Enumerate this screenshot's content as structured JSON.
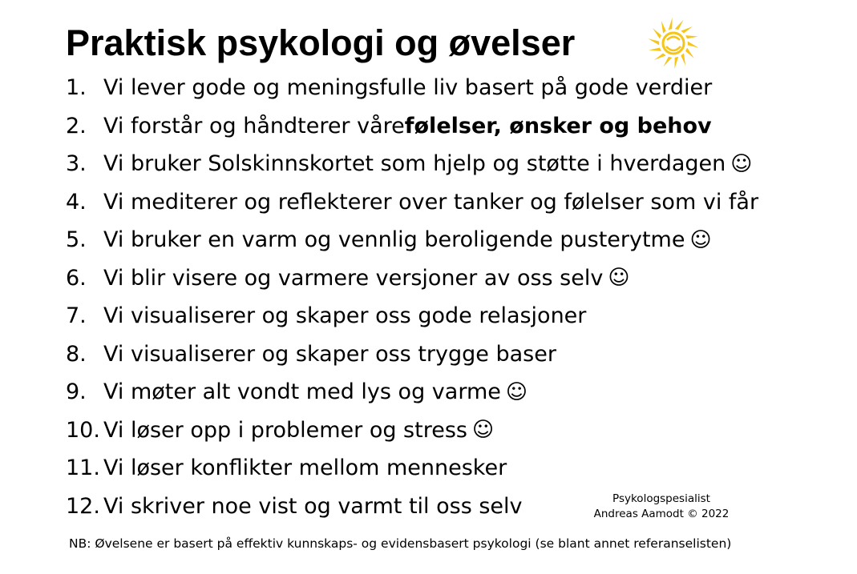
{
  "title": "Praktisk psykologi og øvelser",
  "sun_icon": "sun-icon",
  "accent_color": "#F5C518",
  "items": [
    {
      "num": "1.",
      "text": "Vi lever gode og meningsfulle liv basert på gode verdier",
      "bold": "",
      "smiley": ""
    },
    {
      "num": "2.",
      "text": "Vi forstår og håndterer våre ",
      "bold": "følelser, ønsker og behov",
      "smiley": ""
    },
    {
      "num": "3.",
      "text": "Vi bruker Solskinnskortet som hjelp og støtte i hverdagen",
      "bold": "",
      "smiley": "☺"
    },
    {
      "num": "4.",
      "text": "Vi mediterer og reflekterer over tanker og følelser som vi får",
      "bold": "",
      "smiley": ""
    },
    {
      "num": "5.",
      "text": "Vi bruker en varm og vennlig beroligende pusterytme",
      "bold": "",
      "smiley": "☺"
    },
    {
      "num": "6.",
      "text": "Vi blir visere og varmere versjoner av oss selv",
      "bold": "",
      "smiley": "☺"
    },
    {
      "num": "7.",
      "text": "Vi visualiserer og skaper oss gode relasjoner",
      "bold": "",
      "smiley": ""
    },
    {
      "num": "8.",
      "text": "Vi visualiserer og skaper oss trygge baser",
      "bold": "",
      "smiley": ""
    },
    {
      "num": "9.",
      "text": "Vi møter alt vondt med lys og varme",
      "bold": "",
      "smiley": "☺"
    },
    {
      "num": "10.",
      "text": "Vi løser opp i problemer og stress",
      "bold": "",
      "smiley": "☺"
    },
    {
      "num": "11.",
      "text": "Vi løser konflikter mellom mennesker",
      "bold": "",
      "smiley": ""
    },
    {
      "num": "12.",
      "text": "Vi skriver noe vist og varmt til oss selv",
      "bold": "",
      "smiley": ""
    }
  ],
  "credit": {
    "line1": "Psykologspesialist",
    "line2": "Andreas Aamodt © 2022"
  },
  "note": "NB: Øvelsene er basert på effektiv kunnskaps- og evidensbasert psykologi (se blant annet referanselisten)"
}
